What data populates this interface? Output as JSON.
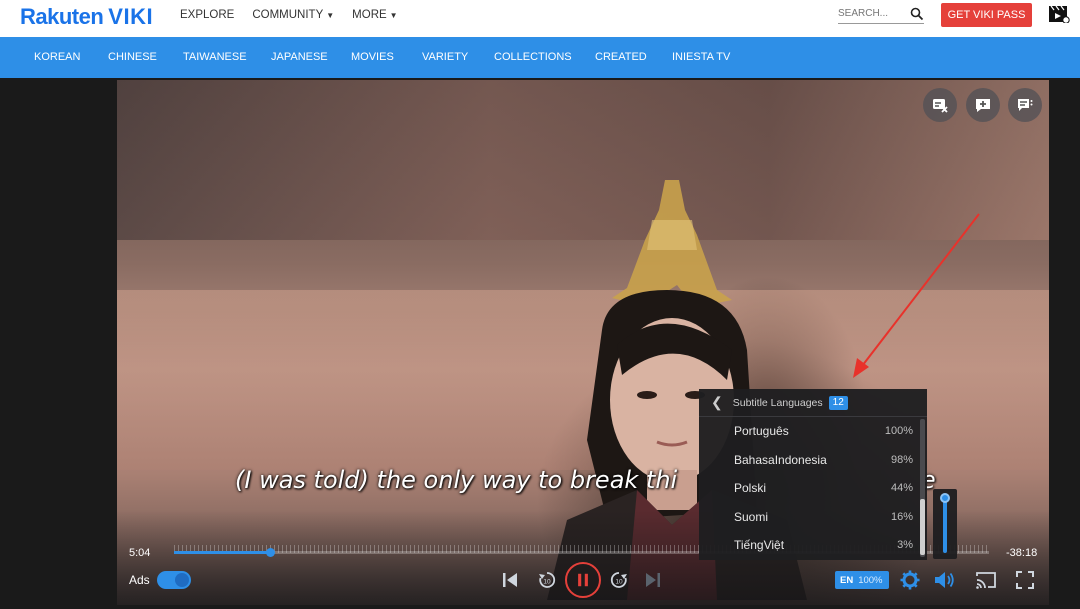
{
  "header": {
    "logo_left": "Rakuten",
    "logo_right": "VIKI",
    "nav": [
      {
        "label": "EXPLORE",
        "dropdown": false
      },
      {
        "label": "COMMUNITY",
        "dropdown": true
      },
      {
        "label": "MORE",
        "dropdown": true
      }
    ],
    "search_placeholder": "SEARCH...",
    "cta_label": "GET VIKI PASS"
  },
  "genres": [
    "KOREAN",
    "CHINESE",
    "TAIWANESE",
    "JAPANESE",
    "MOVIES",
    "VARIETY",
    "COLLECTIONS",
    "CREATED",
    "INIESTA TV"
  ],
  "player": {
    "subtitle_text": "(I was told) the only way to break thi",
    "subtitle_tail": "e",
    "elapsed": "5:04",
    "remaining": "-38:18",
    "progress_fraction": 0.118,
    "ads_label": "Ads",
    "ads_enabled": true,
    "caption_badge": {
      "lang": "EN",
      "percent": "100%"
    },
    "volume_fraction": 1.0
  },
  "subtitle_menu": {
    "title": "Subtitle Languages",
    "count": "12",
    "languages": [
      {
        "name": "Português",
        "percent": "100%"
      },
      {
        "name": "BahasaIndonesia",
        "percent": "98%"
      },
      {
        "name": "Polski",
        "percent": "44%"
      },
      {
        "name": "Suomi",
        "percent": "16%"
      },
      {
        "name": "TiếngViệt",
        "percent": "3%"
      }
    ]
  },
  "colors": {
    "brand_blue": "#2e8fe7",
    "cta_red": "#e5403a",
    "annotation_red": "#e8322b"
  },
  "icons": {
    "corner": [
      "subtitle-off-icon",
      "add-note-icon",
      "comments-icon"
    ],
    "controls": [
      "skip-back-icon",
      "rewind-10-icon",
      "pause-icon",
      "forward-10-icon",
      "skip-forward-icon",
      "settings-gear-icon",
      "volume-icon",
      "cast-icon",
      "fullscreen-icon"
    ]
  }
}
